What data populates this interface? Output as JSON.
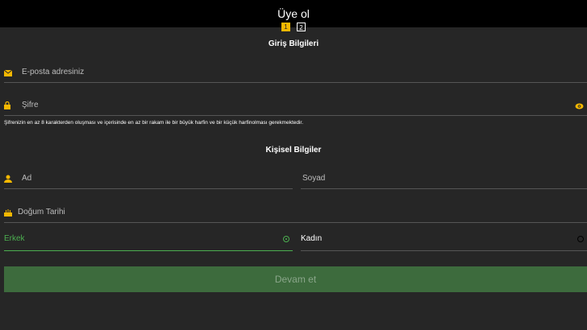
{
  "header": {
    "title": "Üye ol"
  },
  "steps": [
    "1",
    "2"
  ],
  "login_section": {
    "title": "Giriş Bilgileri",
    "email_placeholder": "E-posta adresiniz",
    "password_placeholder": "Şifre",
    "password_hint": "Şifrenizin en az 8 karakterden oluşması ve içerisinde en az bir rakam ile bir büyük harfin ve bir küçük harfinolması gerekmektedir."
  },
  "personal_section": {
    "title": "Kişisel Bilgiler",
    "first_name_placeholder": "Ad",
    "last_name_placeholder": "Soyad",
    "birthdate_placeholder": "Doğum Tarihi",
    "gender_male": "Erkek",
    "gender_female": "Kadın"
  },
  "submit_label": "Devam et",
  "colors": {
    "accent": "#f5b800",
    "selected": "#4caf50",
    "button": "#3d6b3d"
  }
}
